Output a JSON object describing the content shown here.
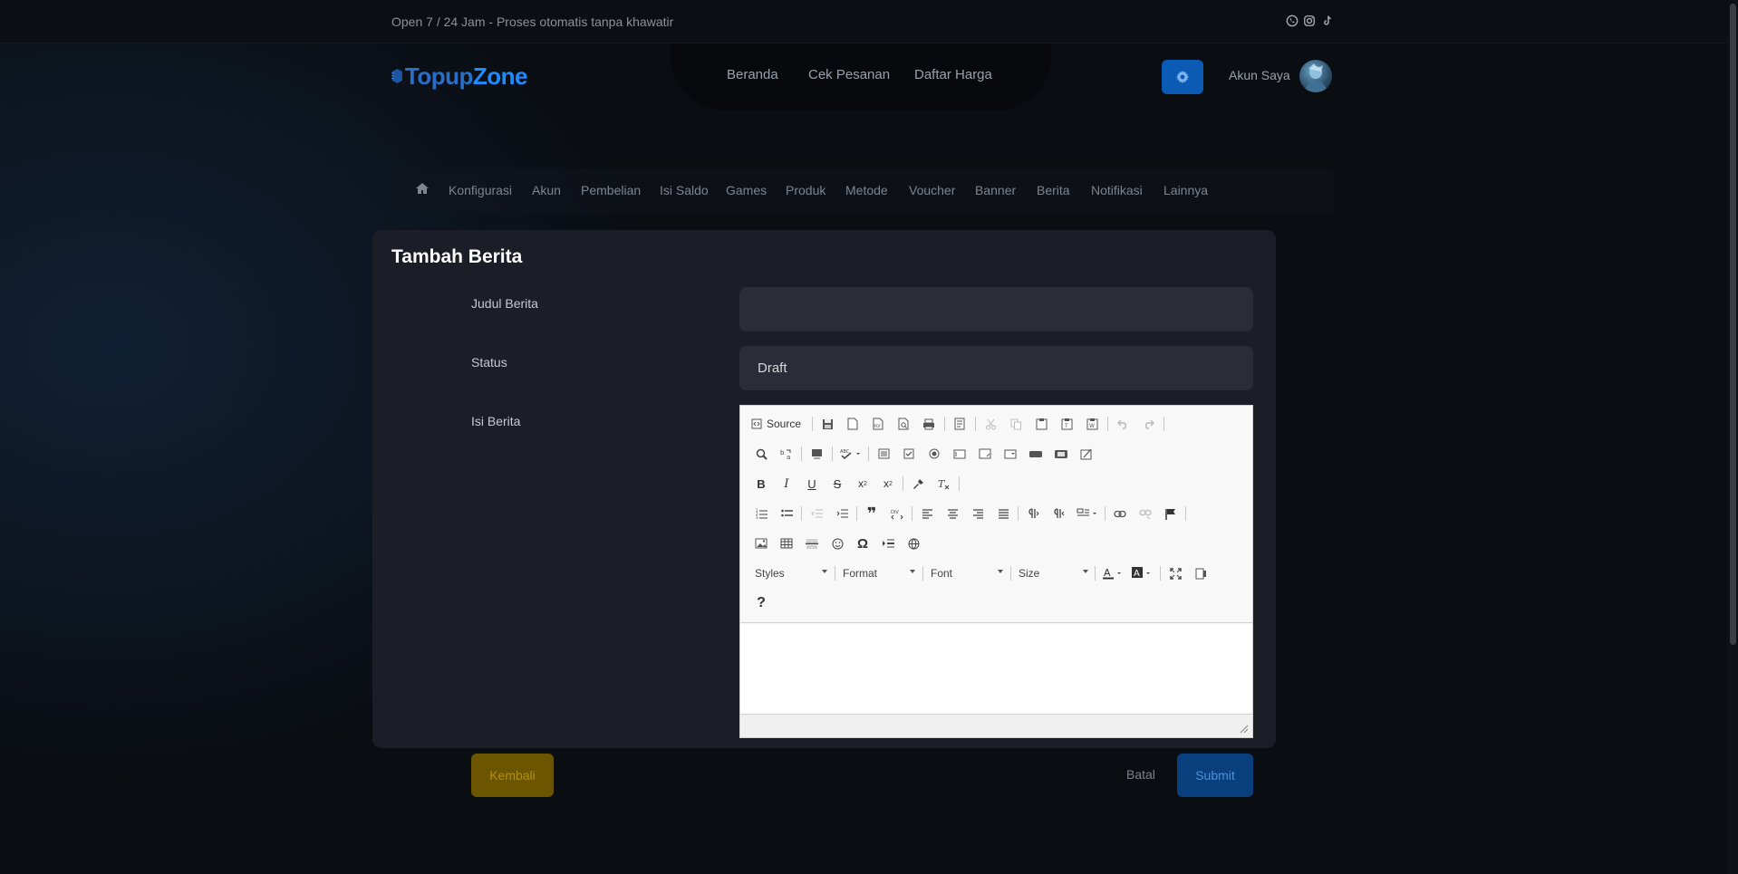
{
  "topbar": {
    "text": "Open 7 / 24 Jam - Proses otomatis tanpa khawatir",
    "social_icons": [
      "whatsapp-icon",
      "instagram-icon",
      "tiktok-icon"
    ]
  },
  "header": {
    "logo": {
      "part1": "Topup",
      "part2": "Zone"
    },
    "nav": [
      "Beranda",
      "Cek Pesanan",
      "Daftar Harga"
    ],
    "account_label": "Akun Saya"
  },
  "subnav": {
    "items": [
      "Konfigurasi",
      "Akun",
      "Pembelian",
      "Isi Saldo",
      "Games",
      "Produk",
      "Metode",
      "Voucher",
      "Banner",
      "Berita",
      "Notifikasi",
      "Lainnya"
    ]
  },
  "form": {
    "title": "Tambah Berita",
    "judul_label": "Judul Berita",
    "judul_value": "",
    "status_label": "Status",
    "status_value": "Draft",
    "isi_label": "Isi Berita"
  },
  "editor": {
    "source_label": "Source",
    "styles_label": "Styles",
    "format_label": "Format",
    "font_label": "Font",
    "size_label": "Size",
    "help_label": "?"
  },
  "actions": {
    "back_label": "Kembali",
    "cancel_label": "Batal",
    "submit_label": "Submit"
  },
  "colors": {
    "primary": "#0b5bb5",
    "warning": "#6b5500",
    "card_bg": "#1b1e26"
  }
}
